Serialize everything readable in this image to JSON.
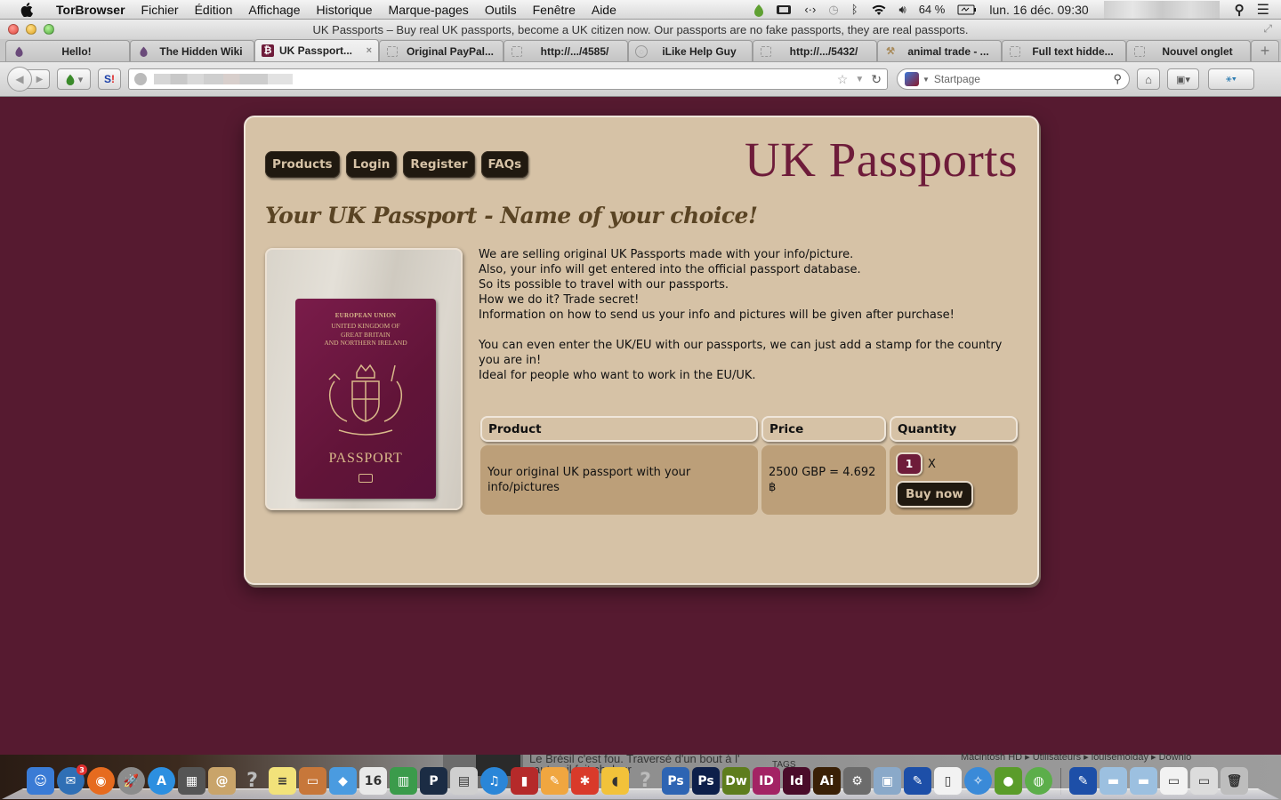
{
  "menubar": {
    "app_name": "TorBrowser",
    "menus": [
      "Fichier",
      "Édition",
      "Affichage",
      "Historique",
      "Marque-pages",
      "Outils",
      "Fenêtre",
      "Aide"
    ],
    "battery": "64 %",
    "datetime": "lun. 16 déc. 09:30",
    "status_icons": [
      "tor-onion-icon",
      "battery-monitor-icon",
      "code-icon",
      "time-machine-icon",
      "bluetooth-icon",
      "wifi-icon",
      "volume-icon",
      "battery-icon",
      "spotlight-icon",
      "notification-list-icon"
    ]
  },
  "window": {
    "title": "UK Passports – Buy real UK passports, become a UK citizen now. Our passports are no fake passports, they are real passports."
  },
  "tabs": [
    {
      "label": "Hello!",
      "icon": "tor-onion-icon",
      "active": false
    },
    {
      "label": "The Hidden Wiki",
      "icon": "tor-onion-icon",
      "active": false
    },
    {
      "label": "UK Passport...",
      "icon": "bitcoin-icon",
      "active": true
    },
    {
      "label": "Original PayPal...",
      "icon": "blank-page-icon",
      "active": false
    },
    {
      "label": "http://.../4585/",
      "icon": "blank-page-icon",
      "active": false
    },
    {
      "label": "iLike Help Guy",
      "icon": "globe-icon",
      "active": false
    },
    {
      "label": "http://.../5432/",
      "icon": "blank-page-icon",
      "active": false
    },
    {
      "label": "animal trade - ...",
      "icon": "hammer-icon",
      "active": false
    },
    {
      "label": "Full text hidde...",
      "icon": "blank-page-icon",
      "active": false
    },
    {
      "label": "Nouvel onglet",
      "icon": "blank-page-icon",
      "active": false
    }
  ],
  "tab_close_glyph": "×",
  "new_tab_glyph": "+",
  "navbar": {
    "search_placeholder": "Startpage",
    "url_value": ""
  },
  "site": {
    "title": "UK Passports",
    "nav": [
      "Products",
      "Login",
      "Register",
      "FAQs"
    ],
    "headline": "Your UK Passport - Name of your choice!",
    "image_alt": "Photo of a burgundy UK passport on a wooden table",
    "passport_cover": {
      "line1": "EUROPEAN UNION",
      "line2": "UNITED KINGDOM OF",
      "line3": "GREAT BRITAIN",
      "line4": "AND NORTHERN IRELAND",
      "word": "PASSPORT"
    },
    "description": [
      "We are selling original UK Passports made with your info/picture.",
      "Also, your info will get entered into the official passport database.",
      "So its possible to travel with our passports.",
      "How we do it? Trade secret!",
      "Information on how to send us your info and pictures will be given after purchase!",
      "",
      "You can even enter the UK/EU with our passports, we can just add a stamp for the country you are in!",
      "Ideal for people who want to work in the EU/UK."
    ],
    "table": {
      "headers": [
        "Product",
        "Price",
        "Quantity"
      ],
      "rows": [
        {
          "product": "Your original UK passport with your info/pictures",
          "price": "2500 GBP = 4.692 ฿",
          "quantity": "1",
          "multiplier": "X",
          "buy_label": "Buy now"
        }
      ]
    }
  },
  "colors": {
    "page_background": "#561a30",
    "card_background": "#d6c2a6",
    "title_color": "#6e1c3a",
    "headline_color": "#5a4424",
    "button_background": "#201910",
    "cell_background": "#bc9f79"
  },
  "dock": {
    "background_text_1": "Le Brésil c'est fou. Traversé d'un bout à l'",
    "background_text_2": "autre, il fait chaleur",
    "background_text_3": "Macintosh HD ▸ Utilisateurs ▸ louisemolday ▸ Downlo",
    "tags_label": "TAGS",
    "items": [
      {
        "name": "finder",
        "glyph": "☺",
        "color": "#3a7bd5"
      },
      {
        "name": "thunderbird",
        "glyph": "✉",
        "color": "#2f6fb5",
        "badge": "3"
      },
      {
        "name": "firefox",
        "glyph": "◉",
        "color": "#e66b1f"
      },
      {
        "name": "launchpad",
        "glyph": "🚀",
        "color": "#8c8c8c"
      },
      {
        "name": "app-store",
        "glyph": "A",
        "color": "#2c8fe0"
      },
      {
        "name": "photo-browser",
        "glyph": "▦",
        "color": "#555"
      },
      {
        "name": "address-book",
        "glyph": "@",
        "color": "#c9a46a"
      },
      {
        "name": "unknown-app",
        "glyph": "?",
        "color": "transparent"
      },
      {
        "name": "stickies",
        "glyph": "≡",
        "color": "#f2e27a"
      },
      {
        "name": "keynote",
        "glyph": "▭",
        "color": "#c7773a"
      },
      {
        "name": "dropbox",
        "glyph": "◆",
        "color": "#4a9be0"
      },
      {
        "name": "calendar",
        "glyph": "16",
        "color": "#e9e9e9"
      },
      {
        "name": "numbers",
        "glyph": "▥",
        "color": "#3b9b4b"
      },
      {
        "name": "pandora",
        "glyph": "P",
        "color": "#1b2c44"
      },
      {
        "name": "image-capture",
        "glyph": "▤",
        "color": "#cfcfcf"
      },
      {
        "name": "itunes",
        "glyph": "♫",
        "color": "#2a86d8"
      },
      {
        "name": "photo-booth",
        "glyph": "▮",
        "color": "#b52a2a"
      },
      {
        "name": "pages",
        "glyph": "✎",
        "color": "#f0a640"
      },
      {
        "name": "tomato-app",
        "glyph": "✱",
        "color": "#d93a2a"
      },
      {
        "name": "cyberduck",
        "glyph": "◖",
        "color": "#f2c23a"
      },
      {
        "name": "unknown-app-2",
        "glyph": "?",
        "color": "transparent"
      },
      {
        "name": "photoshop",
        "glyph": "Ps",
        "color": "#2d64b3"
      },
      {
        "name": "photoshop-2",
        "glyph": "Ps",
        "color": "#0d1f4a"
      },
      {
        "name": "dreamweaver",
        "glyph": "Dw",
        "color": "#5e7d1d"
      },
      {
        "name": "indesign",
        "glyph": "ID",
        "color": "#a32364"
      },
      {
        "name": "indesign-2",
        "glyph": "Id",
        "color": "#4a0c2a"
      },
      {
        "name": "illustrator",
        "glyph": "Ai",
        "color": "#3a2006"
      },
      {
        "name": "automator",
        "glyph": "⚙",
        "color": "#6c6c6c"
      },
      {
        "name": "preview",
        "glyph": "▣",
        "color": "#8aa9c9"
      },
      {
        "name": "cyberghost",
        "glyph": "✎",
        "color": "#1d4fa8"
      },
      {
        "name": "document",
        "glyph": "▯",
        "color": "#f2f2f2"
      },
      {
        "name": "safari",
        "glyph": "✧",
        "color": "#3a8ad8"
      },
      {
        "name": "tor-browser",
        "glyph": "●",
        "color": "#5a9c2a"
      },
      {
        "name": "vidalia",
        "glyph": "◍",
        "color": "#5cae4a"
      },
      {
        "name": "cyberghost-2",
        "glyph": "✎",
        "color": "#1d4fa8"
      },
      {
        "name": "applications-folder",
        "glyph": "▬",
        "color": "#9cc0e0"
      },
      {
        "name": "documents-folder",
        "glyph": "▬",
        "color": "#9cc0e0"
      },
      {
        "name": "downloads-stack",
        "glyph": "▭",
        "color": "#f2f2f2"
      },
      {
        "name": "screenshot-stack",
        "glyph": "▭",
        "color": "#dcdcdc"
      },
      {
        "name": "trash",
        "glyph": "🗑",
        "color": "#bdbdbd"
      }
    ]
  }
}
